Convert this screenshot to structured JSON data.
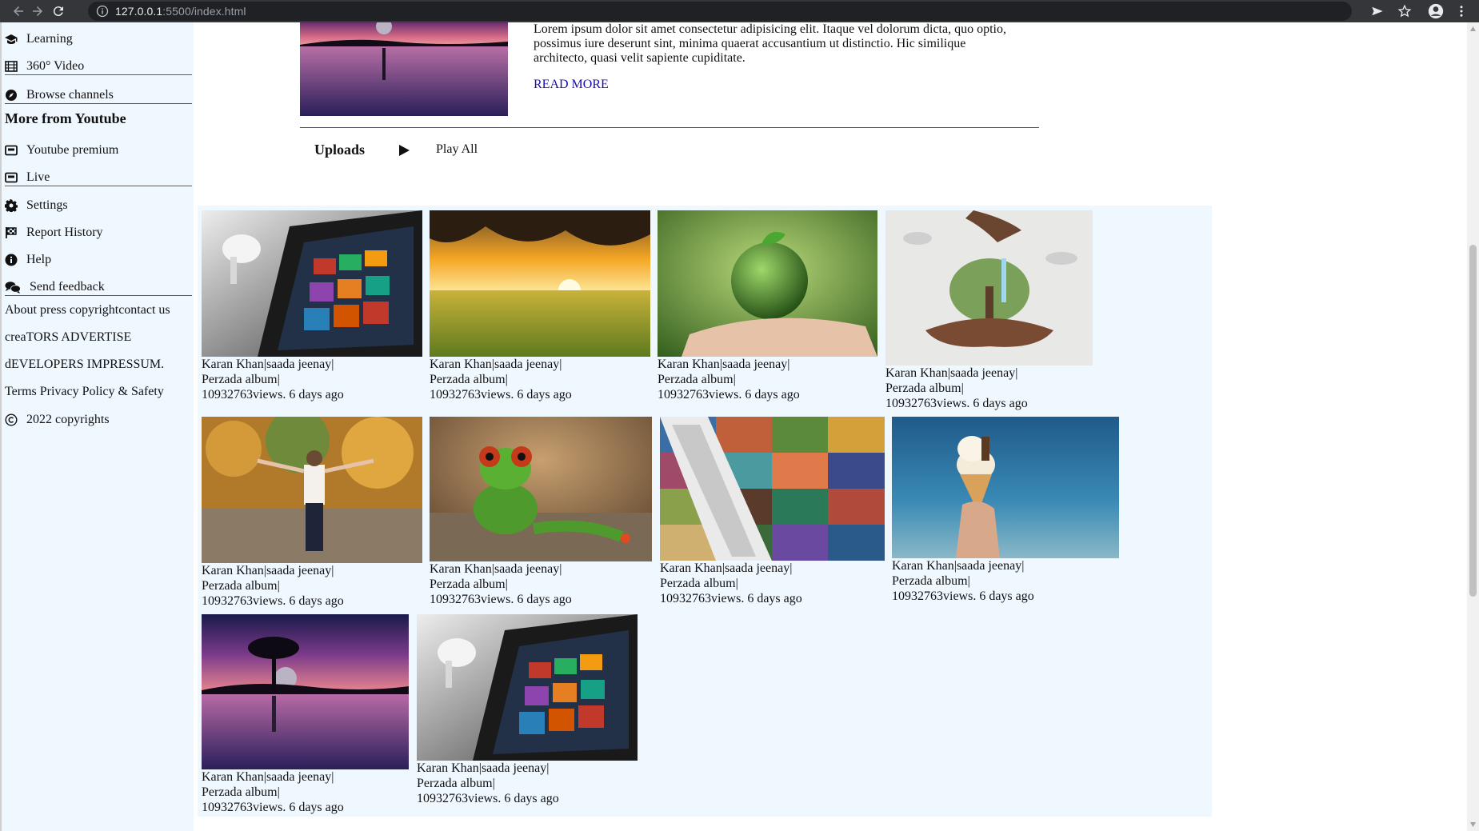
{
  "browser": {
    "url_host": "127.0.0.1",
    "url_rest": ":5500/index.html"
  },
  "sidebar": {
    "items_top": [
      {
        "label": "Learning",
        "icon": "graduation-cap-icon"
      },
      {
        "label": "360° Video",
        "icon": "film-icon"
      },
      {
        "label": "Browse channels",
        "icon": "compass-icon"
      }
    ],
    "more_heading": "More from Youtube",
    "items_more": [
      {
        "label": "Youtube premium",
        "icon": "youtube-box-icon"
      },
      {
        "label": "Live",
        "icon": "live-box-icon"
      }
    ],
    "items_settings": [
      {
        "label": "Settings",
        "icon": "gear-icon"
      },
      {
        "label": "Report History",
        "icon": "flag-icon"
      },
      {
        "label": "Help",
        "icon": "info-icon"
      },
      {
        "label": "Send feedback",
        "icon": "comments-icon"
      }
    ],
    "footer_lines": [
      "About press copyrightcontact us",
      "creaTORS ADVERTISE",
      "dEVELOPERS IMPRESSUM.",
      "Terms Privacy Policy & Safety"
    ],
    "copyright": "2022 copyrights"
  },
  "featured": {
    "description": "Lorem ipsum dolor sit amet consectetur adipisicing elit. Itaque vel dolorum dicta, quo optio, possimus iure deserunt sint, minima quaerat accusantium ut distinctio. Hic similique architecto, quasi velit sapiente cupiditate.",
    "read_more": "READ MORE"
  },
  "uploads": {
    "title": "Uploads",
    "play_all": "Play All"
  },
  "videos": [
    {
      "line1": "Karan Khan|saada jeenay|",
      "line2": "Perzada album|",
      "line3": "10932763views. 6 days ago",
      "image": "laptop-screen"
    },
    {
      "line1": "Karan Khan|saada jeenay|",
      "line2": "Perzada album|",
      "line3": "10932763views. 6 days ago",
      "image": "sunset-field"
    },
    {
      "line1": "Karan Khan|saada jeenay|",
      "line2": "Perzada album|",
      "line3": "10932763views. 6 days ago",
      "image": "globe-in-hand"
    },
    {
      "line1": "Karan Khan|saada jeenay|",
      "line2": "Perzada album|",
      "line3": "10932763views. 6 days ago",
      "image": "hands-with-tree"
    },
    {
      "line1": "Karan Khan|saada jeenay|",
      "line2": "Perzada album|",
      "line3": "10932763views. 6 days ago",
      "image": "woman-autumn"
    },
    {
      "line1": "Karan Khan|saada jeenay|",
      "line2": "Perzada album|",
      "line3": "10932763views. 6 days ago",
      "image": "frog-figure"
    },
    {
      "line1": "Karan Khan|saada jeenay|",
      "line2": "Perzada album|",
      "line3": "10932763views. 6 days ago",
      "image": "photo-collage-zipper"
    },
    {
      "line1": "Karan Khan|saada jeenay|",
      "line2": "Perzada album|",
      "line3": "10932763views. 6 days ago",
      "image": "ice-cream-beach"
    },
    {
      "line1": "Karan Khan|saada jeenay|",
      "line2": "Perzada album|",
      "line3": "10932763views. 6 days ago",
      "image": "tree-reflection-purple"
    },
    {
      "line1": "Karan Khan|saada jeenay|",
      "line2": "Perzada album|",
      "line3": "10932763views. 6 days ago",
      "image": "laptop-screen"
    }
  ],
  "colors": {
    "sidebar_bg": "#f0f8ff",
    "link": "#1a0dab",
    "chrome_bg": "#35363a"
  }
}
